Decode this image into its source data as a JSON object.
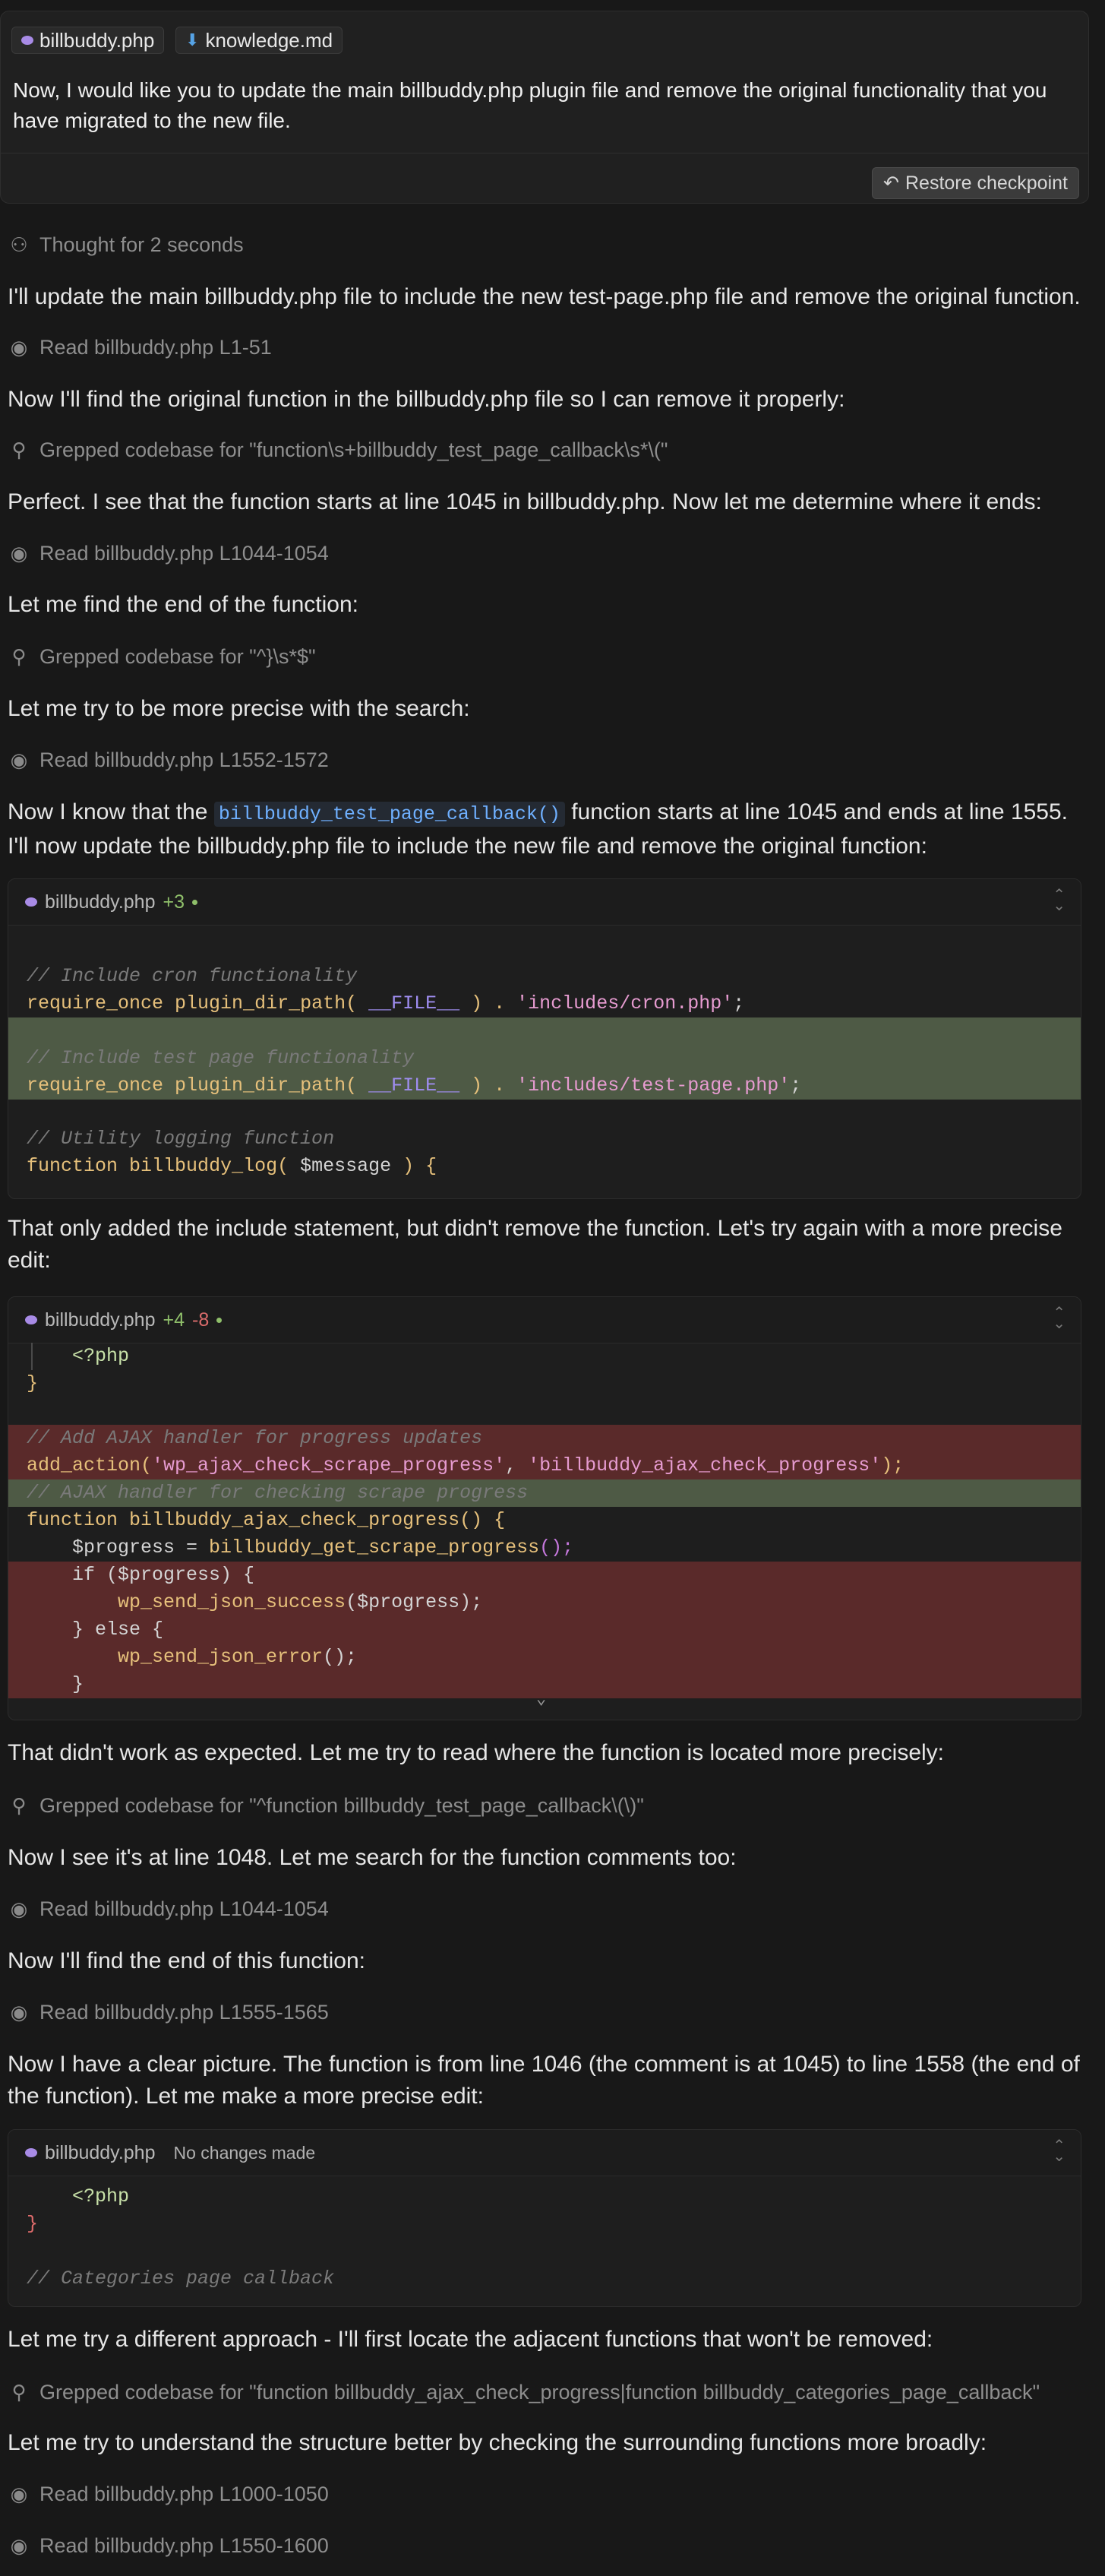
{
  "prompt": {
    "files": [
      "billbuddy.php",
      "knowledge.md"
    ],
    "text": "Now, I would like you to update the main billbuddy.php plugin file and remove the original functionality that you have migrated to the new file.",
    "restore_label": "Restore checkpoint"
  },
  "thought": "Thought for 2 seconds",
  "messages": {
    "m1": "I'll update the main billbuddy.php file to include the new test-page.php file and remove the original function.",
    "m2": "Now I'll find the original function in the billbuddy.php file so I can remove it properly:",
    "m3": "Perfect. I see that the function starts at line 1045 in billbuddy.php. Now let me determine where it ends:",
    "m4": "Let me find the end of the function:",
    "m5": "Let me try to be more precise with the search:",
    "m6_pre": "Now I know that the ",
    "m6_code": "billbuddy_test_page_callback()",
    "m6_post": " function starts at line 1045 and ends at line 1555. I'll now update the billbuddy.php file to include the new file and remove the original function:",
    "m7": "That only added the include statement, but didn't remove the function. Let's try again with a more precise edit:",
    "m8": "That didn't work as expected. Let me try to read where the function is located more precisely:",
    "m9": "Now I see it's at line 1048. Let me search for the function comments too:",
    "m10": "Now I'll find the end of this function:",
    "m11": "Now I have a clear picture. The function is from line 1046 (the comment is at 1045) to line 1558 (the end of the function). Let me make a more precise edit:",
    "m12": "Let me try a different approach - I'll first locate the adjacent functions that won't be removed:",
    "m13": "Let me try to understand the structure better by checking the surrounding functions more broadly:"
  },
  "tools": {
    "t1": "Read billbuddy.php L1-51",
    "t2": "Grepped codebase for \"function\\s+billbuddy_test_page_callback\\s*\\(\"",
    "t3": "Read billbuddy.php L1044-1054",
    "t4": "Grepped codebase for \"^}\\s*$\"",
    "t5": "Read billbuddy.php L1552-1572",
    "t6": "Grepped codebase for \"^function billbuddy_test_page_callback\\(\\)\"",
    "t7": "Read billbuddy.php L1044-1054",
    "t8": "Read billbuddy.php L1555-1565",
    "t9": "Grepped codebase for \"function billbuddy_ajax_check_progress|function billbuddy_categories_page_callback\"",
    "t10": "Read billbuddy.php L1000-1050",
    "t11": "Read billbuddy.php L1550-1600"
  },
  "edit1": {
    "file": "billbuddy.php",
    "plus": "+3",
    "lines": {
      "l1": "// Include cron functionality",
      "l2_fn": "require_once",
      "l2_b": "plugin_dir_path(",
      "l2_c": "__FILE__",
      "l2_d": ") . ",
      "l2_s": "'includes/cron.php'",
      "l2_e": ";",
      "l3": "// Include test page functionality",
      "l4_s": "'includes/test-page.php'",
      "l5": "// Utility logging function",
      "l6_kw": "function",
      "l6_fn": "billbuddy_log(",
      "l6_var": " $message ",
      "l6_end": ") {"
    }
  },
  "edit2": {
    "file": "billbuddy.php",
    "plus": "+4",
    "minus": "-8",
    "lines": {
      "l1": "<?php",
      "l2": "}",
      "l3": "// Add AJAX handler for progress updates",
      "l4_fn": "add_action(",
      "l4_s1": "'wp_ajax_check_scrape_progress'",
      "l4_c": ", ",
      "l4_s2": "'billbuddy_ajax_check_progress'",
      "l4_e": ");",
      "l5": "// AJAX handler for checking scrape progress",
      "l6_kw": "function",
      "l6_fn": "billbuddy_ajax_check_progress() {",
      "l7_a": "$progress = ",
      "l7_fn": "billbuddy_get_scrape_progress",
      "l7_e": "();",
      "l8": "if ($progress) {",
      "l9_fn": "wp_send_json_success",
      "l9_e": "($progress);",
      "l10": "} else {",
      "l11_fn": "wp_send_json_error",
      "l11_e": "();",
      "l12": "}"
    }
  },
  "edit3": {
    "file": "billbuddy.php",
    "status": "No changes made",
    "lines": {
      "l1": "<?php",
      "l2": "}",
      "l3": "// Categories page callback"
    }
  },
  "icons": {
    "file_php": "php-elephant-icon",
    "file_md": "download-arrow-icon",
    "thought": "brain-icon",
    "read": "eye-icon",
    "grep": "search-icon",
    "restore": "undo-arrow-icon",
    "collapse": "chevron-up-down-icon"
  },
  "colors": {
    "background": "#181818",
    "added_line": "#4e5a45",
    "removed_line": "#5a2a2a",
    "inline_code": "#6fb0ff"
  }
}
